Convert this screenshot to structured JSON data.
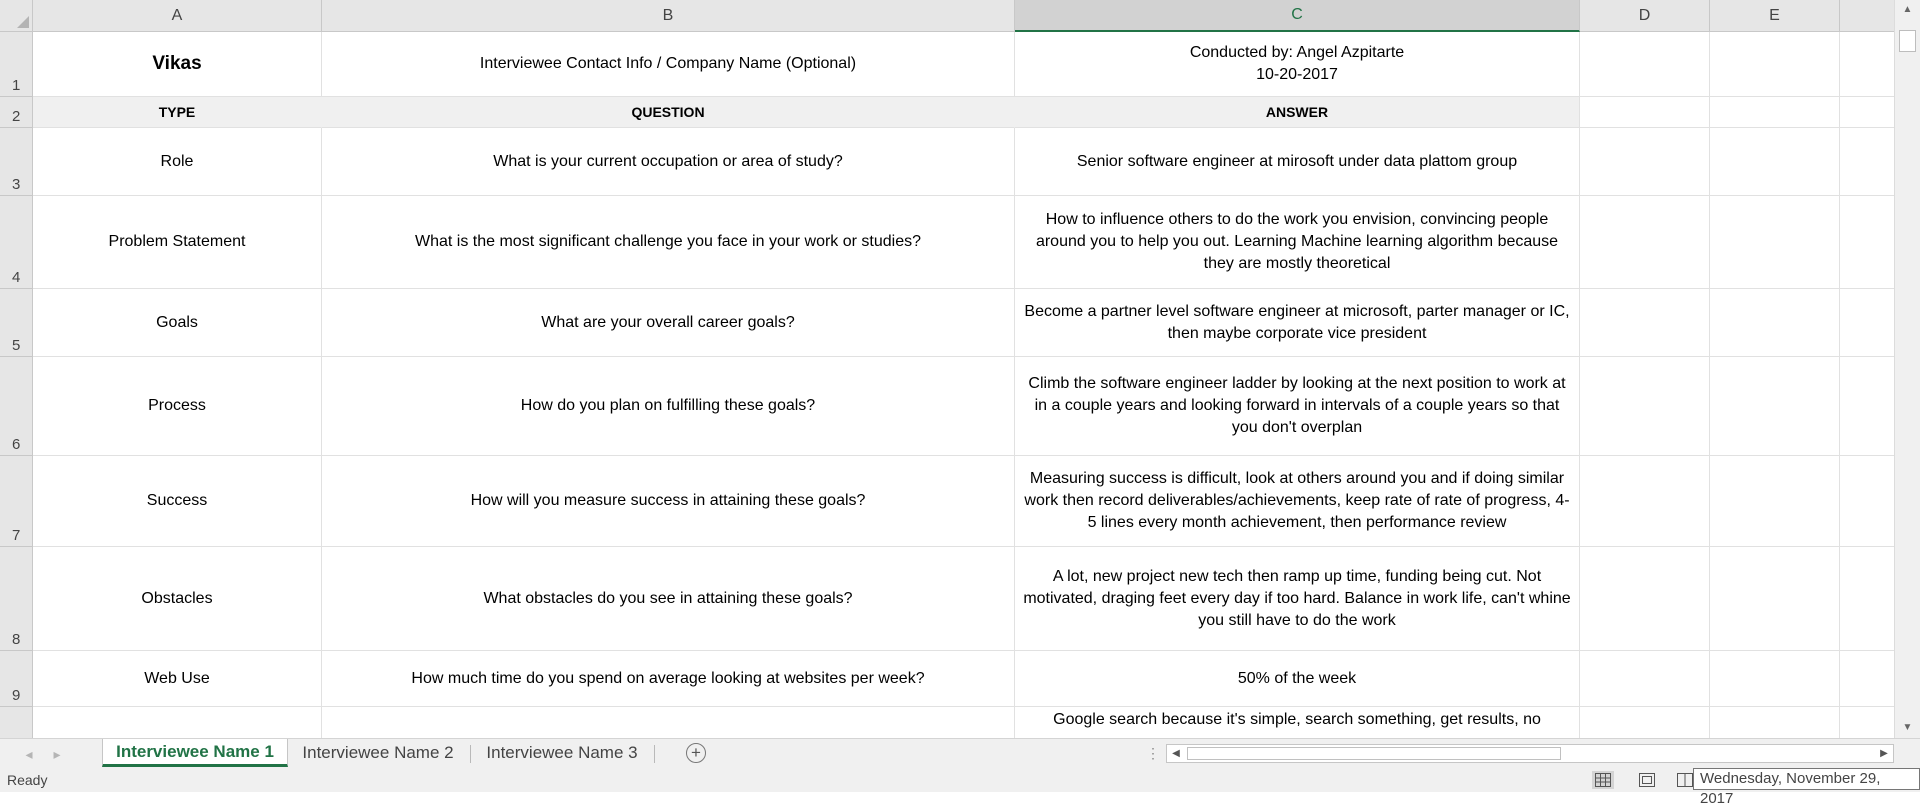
{
  "columns": [
    "A",
    "B",
    "C",
    "D",
    "E"
  ],
  "selected_column": "C",
  "rows": [
    {
      "num": "1",
      "a": "Vikas",
      "b": "Interviewee Contact Info / Company Name (Optional)",
      "c": "Conducted by: Angel Azpitarte\n10-20-2017"
    },
    {
      "num": "2",
      "a": "TYPE",
      "b": "QUESTION",
      "c": "ANSWER"
    },
    {
      "num": "3",
      "a": "Role",
      "b": "What is your current occupation or area of study?",
      "c": "Senior software engineer at mirosoft under data plattom group"
    },
    {
      "num": "4",
      "a": "Problem Statement",
      "b": "What is the most significant challenge you face in your work or studies?",
      "c": "How to influence others to do the work you envision, convincing people around you to help you out. Learning Machine learning algorithm because they are mostly theoretical"
    },
    {
      "num": "5",
      "a": "Goals",
      "b": "What are your overall career goals?",
      "c": "Become a partner level software engineer at microsoft, parter manager or IC, then maybe corporate vice president"
    },
    {
      "num": "6",
      "a": "Process",
      "b": "How do you plan on fulfilling these goals?",
      "c": "Climb the software engineer ladder by looking at the next position to work at in a couple years and looking forward in intervals of a couple years so that you don't overplan"
    },
    {
      "num": "7",
      "a": "Success",
      "b": "How will you measure success in attaining these goals?",
      "c": "Measuring success is difficult, look at others around you and if doing similar work then record deliverables/achievements, keep rate of rate of progress, 4-5 lines every month achievement, then performance review"
    },
    {
      "num": "8",
      "a": "Obstacles",
      "b": "What obstacles do you see in attaining these goals?",
      "c": "A lot, new project new tech then ramp up time, funding being cut. Not motivated, draging feet every day if too hard. Balance in work life, can't whine you still have to do the work"
    },
    {
      "num": "9",
      "a": "Web Use",
      "b": "How much time do you spend on average looking at websites per week?",
      "c": "50% of the week"
    },
    {
      "num": "",
      "a": "",
      "b": "",
      "c": "Google search because it's simple, search something, get results, no"
    }
  ],
  "sheet_tabs": [
    "Interviewee Name 1",
    "Interviewee Name 2",
    "Interviewee Name 3"
  ],
  "active_tab": 0,
  "add_sheet_symbol": "+",
  "status": {
    "ready": "Ready",
    "tooltip": "Wednesday, November 29, 2017"
  },
  "colors": {
    "accent": "#217346",
    "header_bg": "#e6e6e6",
    "gray_row": "#f0f0f0"
  }
}
